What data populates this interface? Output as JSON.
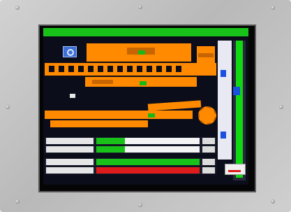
{
  "screen": {
    "title": "",
    "accent_color": "#19c219",
    "machine_color": "#ff8a00",
    "alert_color": "#e01b1b",
    "indicator_color": "#1b4fe0"
  },
  "status_rows": [
    {
      "label": "",
      "level": 0.28,
      "color": "#19c219"
    },
    {
      "label": "",
      "level": 0.28,
      "color": "#19c219"
    },
    {
      "label": "",
      "level": 1.0,
      "color": "#19c219"
    },
    {
      "label": "",
      "level": 1.0,
      "color": "#e01b1b"
    }
  ],
  "icons": {
    "logo": "company-logo-icon",
    "gear": "gear-icon",
    "alarm": "alarm-button-icon"
  }
}
